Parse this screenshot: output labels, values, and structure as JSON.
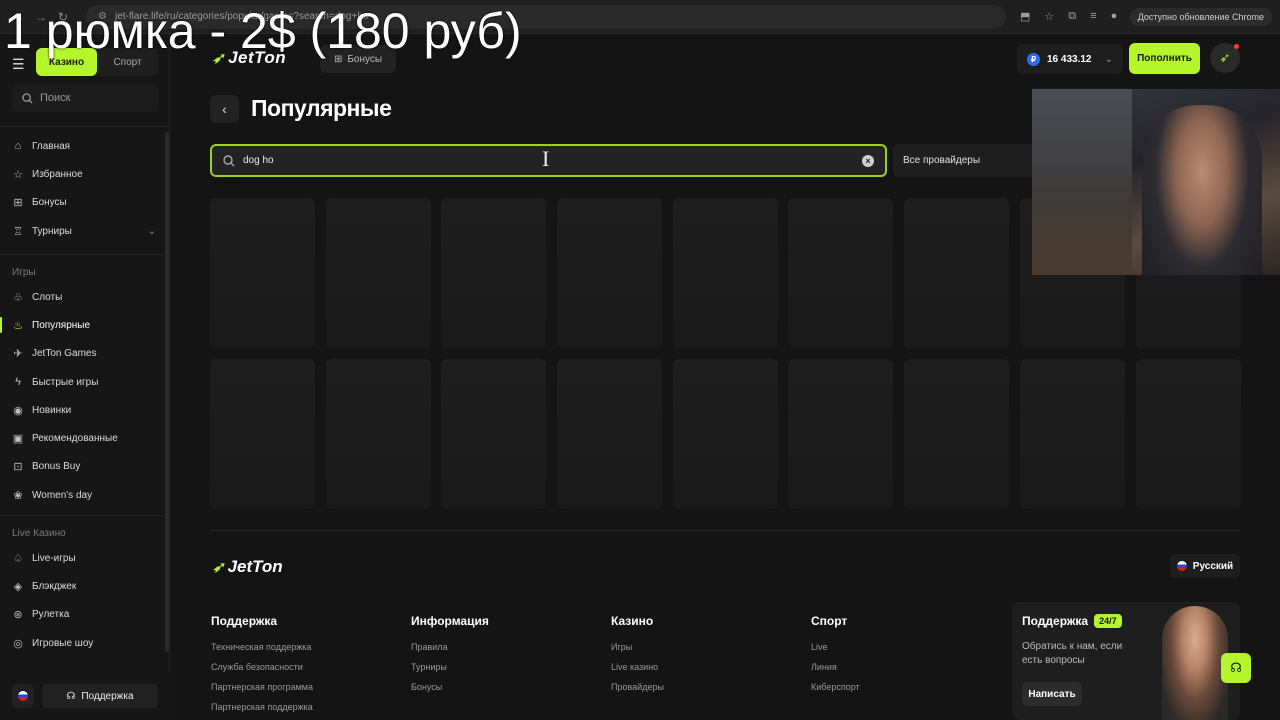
{
  "overlay_caption": "1 рюмка - 2$ (180 руб)",
  "browser": {
    "url": "jet-flare.life/ru/categories/popular/games?search=dog+ho",
    "update_text": "Доступно обновление Chrome"
  },
  "sidebar": {
    "tabs": [
      "Казино",
      "Спорт"
    ],
    "search_placeholder": "Поиск",
    "main_items": [
      {
        "label": "Главная",
        "icon": "home-icon"
      },
      {
        "label": "Избранное",
        "icon": "star-icon"
      },
      {
        "label": "Бонусы",
        "icon": "gift-icon"
      },
      {
        "label": "Турниры",
        "icon": "trophy-icon"
      }
    ],
    "games_title": "Игры",
    "games_items": [
      {
        "label": "Слоты",
        "icon": "cherry-icon"
      },
      {
        "label": "Популярные",
        "icon": "fire-icon",
        "active": true
      },
      {
        "label": "JetTon Games",
        "icon": "jet-icon"
      },
      {
        "label": "Быстрые игры",
        "icon": "bolt-icon"
      },
      {
        "label": "Новинки",
        "icon": "new-icon"
      },
      {
        "label": "Рекомендованные",
        "icon": "recommend-icon"
      },
      {
        "label": "Bonus Buy",
        "icon": "bag-icon"
      },
      {
        "label": "Women's day",
        "icon": "tulip-icon"
      }
    ],
    "live_title": "Live Казино",
    "live_items": [
      {
        "label": "Live-игры",
        "icon": "spade-icon"
      },
      {
        "label": "Блэкджек",
        "icon": "blackjack-icon"
      },
      {
        "label": "Рулетка",
        "icon": "roulette-icon"
      },
      {
        "label": "Игровые шоу",
        "icon": "show-icon"
      }
    ],
    "support_label": "Поддержка"
  },
  "header": {
    "bonus_tab": "Бонусы",
    "balance": "16 433.12",
    "currency_symbol": "₽",
    "deposit_label": "Пополнить"
  },
  "main": {
    "title": "Популярные",
    "search_value": "dog ho",
    "providers_label": "Все провайдеры"
  },
  "footer": {
    "logo_text": "JetTon",
    "language": "Русский",
    "columns": [
      {
        "title": "Поддержка",
        "links": [
          "Техническая поддержка",
          "Служба безопасности",
          "Партнерская программа",
          "Партнерская поддержка"
        ]
      },
      {
        "title": "Информация",
        "links": [
          "Правила",
          "Турниры",
          "Бонусы"
        ]
      },
      {
        "title": "Казино",
        "links": [
          "Игры",
          "Live казино",
          "Провайдеры"
        ]
      },
      {
        "title": "Спорт",
        "links": [
          "Live",
          "Линия",
          "Киберспорт"
        ]
      }
    ],
    "support_card": {
      "title": "Поддержка",
      "badge": "24/7",
      "text": "Обратись к нам, если есть вопросы",
      "button": "Написать"
    }
  },
  "brand": {
    "logo_text": "JetTon",
    "accent": "#b5f52b"
  }
}
